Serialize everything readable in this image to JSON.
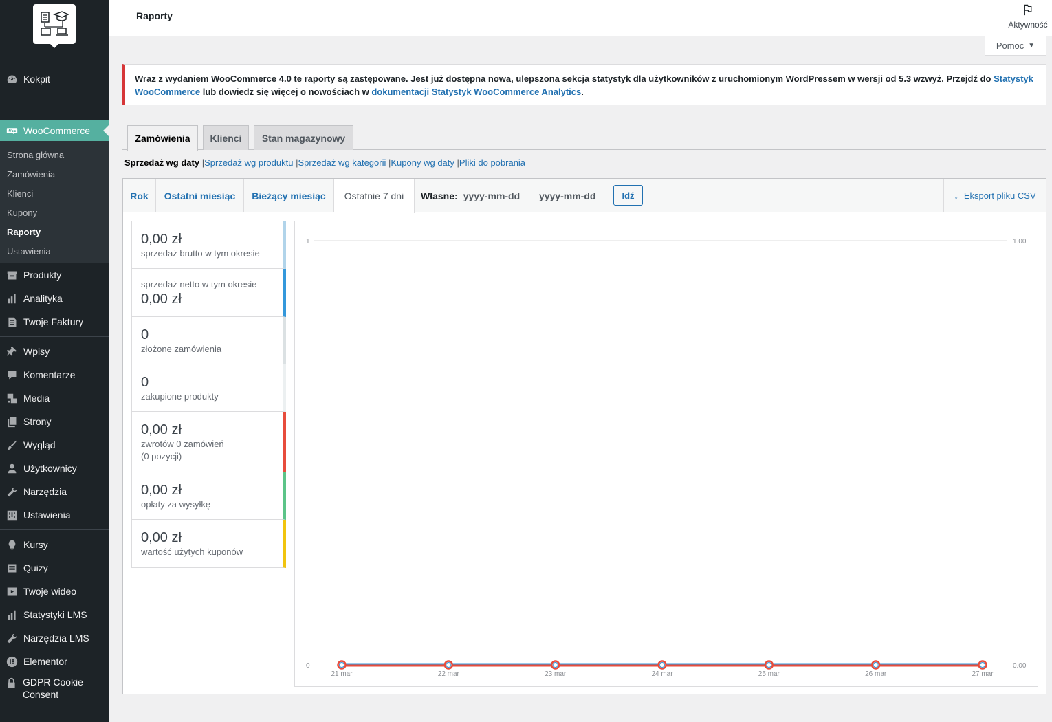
{
  "sidebar": {
    "logo": "logo-icon",
    "items_top": [
      {
        "label": "Kokpit",
        "icon": "dashboard-icon"
      }
    ],
    "woo": {
      "label": "WooCommerce",
      "icon": "woo-icon"
    },
    "submenu": [
      "Strona główna",
      "Zamówienia",
      "Klienci",
      "Kupony",
      "Raporty",
      "Ustawienia"
    ],
    "items_a": [
      {
        "label": "Produkty",
        "icon": "archive-icon"
      },
      {
        "label": "Analityka",
        "icon": "chart-icon"
      },
      {
        "label": "Twoje Faktury",
        "icon": "document-icon"
      }
    ],
    "items_b": [
      {
        "label": "Wpisy",
        "icon": "pin-icon"
      },
      {
        "label": "Komentarze",
        "icon": "comment-icon"
      },
      {
        "label": "Media",
        "icon": "media-icon"
      },
      {
        "label": "Strony",
        "icon": "pages-icon"
      },
      {
        "label": "Wygląd",
        "icon": "brush-icon"
      },
      {
        "label": "Użytkownicy",
        "icon": "user-icon"
      },
      {
        "label": "Narzędzia",
        "icon": "wrench-icon"
      },
      {
        "label": "Ustawienia",
        "icon": "settings-icon"
      }
    ],
    "items_c": [
      {
        "label": "Kursy",
        "icon": "lightbulb-icon"
      },
      {
        "label": "Quizy",
        "icon": "list-icon"
      },
      {
        "label": "Twoje wideo",
        "icon": "video-icon"
      },
      {
        "label": "Statystyki LMS",
        "icon": "chart-icon"
      },
      {
        "label": "Narzędzia LMS",
        "icon": "wrench-icon"
      },
      {
        "label": "Elementor",
        "icon": "elementor-icon"
      },
      {
        "label": "GDPR Cookie Consent",
        "icon": "lock-icon"
      }
    ]
  },
  "topbar": {
    "title": "Raporty",
    "activity": "Aktywność"
  },
  "help": {
    "label": "Pomoc"
  },
  "notice": {
    "text1": "Wraz z wydaniem WooCommerce 4.0 te raporty są zastępowane. Jest już dostępna nowa, ulepszona sekcja statystyk dla użytkowników z uruchomionym WordPressem w wersji od 5.3 wzwyż. Przejdź do ",
    "link1": "Statystyk WooCommerce",
    "text2": " lub dowiedz się więcej o nowościach w ",
    "link2": "dokumentacji Statystyk WooCommerce Analytics",
    "text3": "."
  },
  "tabs": [
    "Zamówienia",
    "Klienci",
    "Stan magazynowy"
  ],
  "subnav": {
    "current": "Sprzedaż wg daty",
    "links": [
      "Sprzedaż wg produktu",
      "Sprzedaż wg kategorii",
      "Kupony wg daty",
      "Pliki do pobrania"
    ]
  },
  "ranges": [
    "Rok",
    "Ostatni miesiąc",
    "Bieżący miesiąc",
    "Ostatnie 7 dni"
  ],
  "custom": {
    "label": "Własne:",
    "from": "yyyy-mm-dd",
    "dash": "–",
    "to": "yyyy-mm-dd",
    "go": "Idź"
  },
  "export": {
    "label": "Eksport pliku CSV"
  },
  "legend": [
    {
      "amount": "0,00 zł",
      "desc": "sprzedaż brutto w tym okresie",
      "color": "#b1d4ea",
      "order": "amount-first"
    },
    {
      "amount": "0,00 zł",
      "desc": "sprzedaż netto w tym okresie",
      "color": "#3498db",
      "order": "desc-first"
    },
    {
      "amount": "0",
      "desc": "złożone zamówienia",
      "color": "#dbe1e3",
      "order": "amount-first"
    },
    {
      "amount": "0",
      "desc": "zakupione produkty",
      "color": "#ecf0f1",
      "order": "amount-first"
    },
    {
      "amount": "0,00 zł",
      "desc": "zwrotów 0 zamówień",
      "desc2": "(0 pozycji)",
      "color": "#e74c3c",
      "order": "amount-first"
    },
    {
      "amount": "0,00 zł",
      "desc": "opłaty za wysyłkę",
      "color": "#5cc488",
      "order": "amount-first"
    },
    {
      "amount": "0,00 zł",
      "desc": "wartość użytych kuponów",
      "color": "#f1c40f",
      "order": "amount-first"
    }
  ],
  "chart_data": {
    "type": "line",
    "categories": [
      "21 mar",
      "22 mar",
      "23 mar",
      "24 mar",
      "25 mar",
      "26 mar",
      "27 mar"
    ],
    "series": [
      {
        "values": [
          0,
          0,
          0,
          0,
          0,
          0,
          0
        ],
        "color": "#3498db"
      },
      {
        "values": [
          0,
          0,
          0,
          0,
          0,
          0,
          0
        ],
        "color": "#e74c3c"
      }
    ],
    "y_left": {
      "ticks": [
        "1",
        "0"
      ],
      "ylim": [
        0,
        1
      ]
    },
    "y_right": {
      "ticks": [
        "1.00",
        "0.00"
      ],
      "ylim": [
        0,
        1
      ]
    },
    "grid": true,
    "xlabel": "",
    "ylabel": "",
    "title": ""
  }
}
